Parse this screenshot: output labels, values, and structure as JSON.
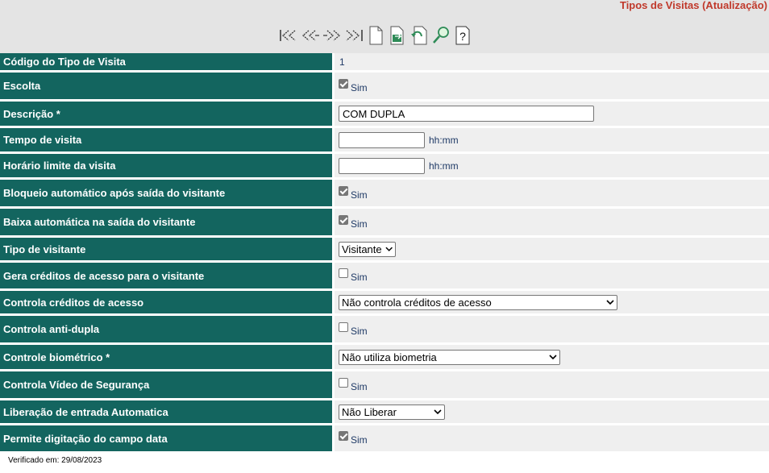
{
  "header": {
    "title": "Tipos de Visitas (Atualização)"
  },
  "toolbar": {
    "icons": [
      "first-record-icon",
      "previous-record-icon",
      "next-record-icon",
      "last-record-icon",
      "new-record-icon",
      "save-icon",
      "undo-icon",
      "search-icon",
      "help-icon"
    ]
  },
  "form": {
    "codigo": {
      "label": "Código do Tipo de Visita",
      "value": "1"
    },
    "escolta": {
      "label": "Escolta",
      "checked": true,
      "option": "Sim"
    },
    "descricao": {
      "label": "Descrição *",
      "value": "COM DUPLA"
    },
    "tempo": {
      "label": "Tempo de visita",
      "value": "",
      "unit": "hh:mm"
    },
    "horario": {
      "label": "Horário limite da visita",
      "value": "",
      "unit": "hh:mm"
    },
    "bloqueio": {
      "label": "Bloqueio automático após saída do visitante",
      "checked": true,
      "option": "Sim"
    },
    "baixa": {
      "label": "Baixa automática na saída do visitante",
      "checked": true,
      "option": "Sim"
    },
    "tipo_visitante": {
      "label": "Tipo de visitante",
      "selected": "Visitante"
    },
    "gera_creditos": {
      "label": "Gera créditos de acesso para o visitante",
      "checked": false,
      "option": "Sim"
    },
    "controla_creditos": {
      "label": "Controla créditos de acesso",
      "selected": "Não controla créditos de acesso"
    },
    "anti_dupla": {
      "label": "Controla anti-dupla",
      "checked": false,
      "option": "Sim"
    },
    "biometrico": {
      "label": "Controle biométrico *",
      "selected": "Não utiliza biometria"
    },
    "video": {
      "label": "Controla Vídeo de Segurança",
      "checked": false,
      "option": "Sim"
    },
    "liberacao": {
      "label": "Liberação de entrada Automatica",
      "selected": "Não Liberar"
    },
    "digitacao_data": {
      "label": "Permite digitação do campo data",
      "checked": true,
      "option": "Sim"
    }
  },
  "footer": {
    "verified": "Verificado em: 29/08/2023"
  },
  "colors": {
    "label_bg": "#13655f",
    "value_bg": "#efefef",
    "title": "#c0392b",
    "value_text": "#1f3a66"
  }
}
